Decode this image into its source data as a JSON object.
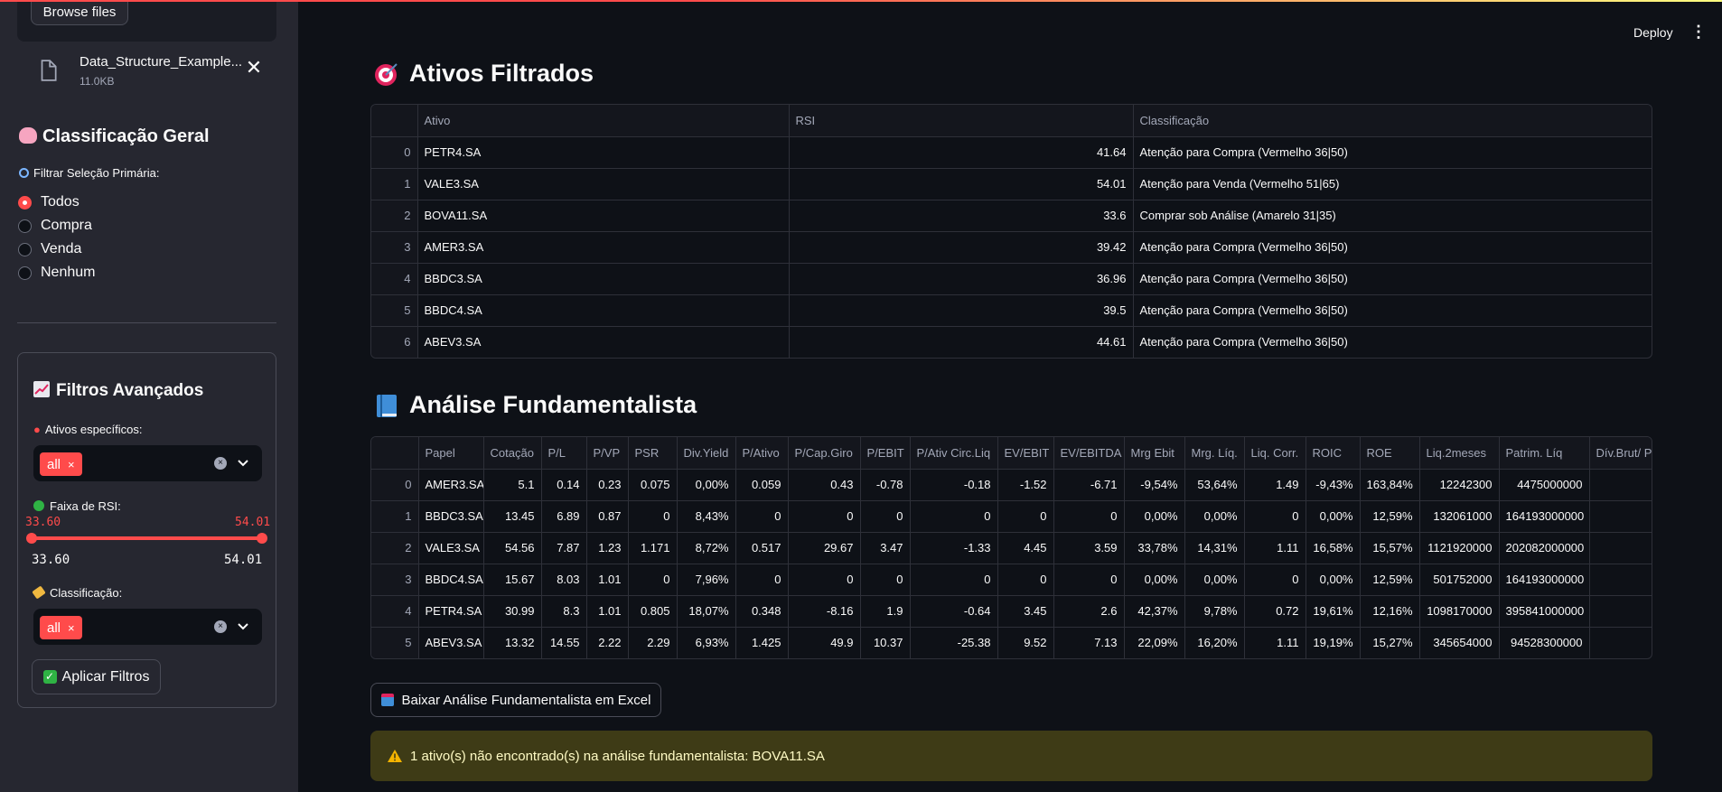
{
  "header": {
    "deploy_label": "Deploy",
    "menu_glyph": "⋮"
  },
  "sidebar": {
    "browse_label": "Browse files",
    "file": {
      "name": "Data_Structure_Example...",
      "size": "11.0KB",
      "close_glyph": "✕"
    },
    "classificacao_title": "Classificação Geral",
    "filtrar_label": "Filtrar Seleção Primária:",
    "radio_options": [
      "Todos",
      "Compra",
      "Venda",
      "Nenhum"
    ],
    "radio_selected": "Todos",
    "filtros_title": "Filtros Avançados",
    "ativos_label": "Ativos específicos:",
    "ativos_tag": "all",
    "rsi_label": "Faixa de RSI:",
    "rsi_min": "33.60",
    "rsi_max": "54.01",
    "classificacao_label": "Classificação:",
    "classificacao_tag": "all",
    "apply_label": "Aplicar Filtros",
    "tag_remove_glyph": "×",
    "clear_glyph": "×"
  },
  "filtrados": {
    "title": "Ativos Filtrados",
    "columns": [
      "",
      "Ativo",
      "RSI",
      "Classificação"
    ],
    "rows": [
      [
        "0",
        "PETR4.SA",
        "41.64",
        "Atenção para Compra (Vermelho 36|50)"
      ],
      [
        "1",
        "VALE3.SA",
        "54.01",
        "Atenção para Venda (Vermelho 51|65)"
      ],
      [
        "2",
        "BOVA11.SA",
        "33.6",
        "Comprar sob Análise (Amarelo 31|35)"
      ],
      [
        "3",
        "AMER3.SA",
        "39.42",
        "Atenção para Compra (Vermelho 36|50)"
      ],
      [
        "4",
        "BBDC3.SA",
        "36.96",
        "Atenção para Compra (Vermelho 36|50)"
      ],
      [
        "5",
        "BBDC4.SA",
        "39.5",
        "Atenção para Compra (Vermelho 36|50)"
      ],
      [
        "6",
        "ABEV3.SA",
        "44.61",
        "Atenção para Compra (Vermelho 36|50)"
      ]
    ]
  },
  "fundamentalista": {
    "title": "Análise Fundamentalista",
    "columns": [
      "",
      "Papel",
      "Cotação",
      "P/L",
      "P/VP",
      "PSR",
      "Div.Yield",
      "P/Ativo",
      "P/Cap.Giro",
      "P/EBIT",
      "P/Ativ Circ.Liq",
      "EV/EBIT",
      "EV/EBITDA",
      "Mrg Ebit",
      "Mrg. Líq.",
      "Liq. Corr.",
      "ROIC",
      "ROE",
      "Liq.2meses",
      "Patrim. Líq",
      "Dív.Brut/ Pa"
    ],
    "rows": [
      [
        "0",
        "AMER3.SA",
        "5.1",
        "0.14",
        "0.23",
        "0.075",
        "0,00%",
        "0.059",
        "0.43",
        "-0.78",
        "-0.18",
        "-1.52",
        "-6.71",
        "-9,54%",
        "53,64%",
        "1.49",
        "-9,43%",
        "163,84%",
        "12242300",
        "4475000000",
        ""
      ],
      [
        "1",
        "BBDC3.SA",
        "13.45",
        "6.89",
        "0.87",
        "0",
        "8,43%",
        "0",
        "0",
        "0",
        "0",
        "0",
        "0",
        "0,00%",
        "0,00%",
        "0",
        "0,00%",
        "12,59%",
        "132061000",
        "164193000000",
        ""
      ],
      [
        "2",
        "VALE3.SA",
        "54.56",
        "7.87",
        "1.23",
        "1.171",
        "8,72%",
        "0.517",
        "29.67",
        "3.47",
        "-1.33",
        "4.45",
        "3.59",
        "33,78%",
        "14,31%",
        "1.11",
        "16,58%",
        "15,57%",
        "1121920000",
        "202082000000",
        ""
      ],
      [
        "3",
        "BBDC4.SA",
        "15.67",
        "8.03",
        "1.01",
        "0",
        "7,96%",
        "0",
        "0",
        "0",
        "0",
        "0",
        "0",
        "0,00%",
        "0,00%",
        "0",
        "0,00%",
        "12,59%",
        "501752000",
        "164193000000",
        ""
      ],
      [
        "4",
        "PETR4.SA",
        "30.99",
        "8.3",
        "1.01",
        "0.805",
        "18,07%",
        "0.348",
        "-8.16",
        "1.9",
        "-0.64",
        "3.45",
        "2.6",
        "42,37%",
        "9,78%",
        "0.72",
        "19,61%",
        "12,16%",
        "1098170000",
        "395841000000",
        ""
      ],
      [
        "5",
        "ABEV3.SA",
        "13.32",
        "14.55",
        "2.22",
        "2.29",
        "6,93%",
        "1.425",
        "49.9",
        "10.37",
        "-25.38",
        "9.52",
        "7.13",
        "22,09%",
        "16,20%",
        "1.11",
        "19,19%",
        "15,27%",
        "345654000",
        "94528300000",
        ""
      ]
    ]
  },
  "download_label": "Baixar Análise Fundamentalista em Excel",
  "alert_text": "1 ativo(s) não encontrado(s) na análise fundamentalista: BOVA11.SA",
  "colors": {
    "accent": "#ff4b4b",
    "sidebar_bg": "#262730",
    "main_bg": "#0e1117",
    "warning_bg": "#3e3b16"
  },
  "icons": [
    "file-icon",
    "close-icon",
    "brain-icon",
    "magnifier-icon",
    "chart-up-icon",
    "pin-icon",
    "green-circle-icon",
    "label-tag-icon",
    "check-box-icon",
    "target-icon",
    "blue-book-icon",
    "mailbox-icon",
    "warning-icon",
    "kebab-menu-icon",
    "chevron-down-icon"
  ]
}
